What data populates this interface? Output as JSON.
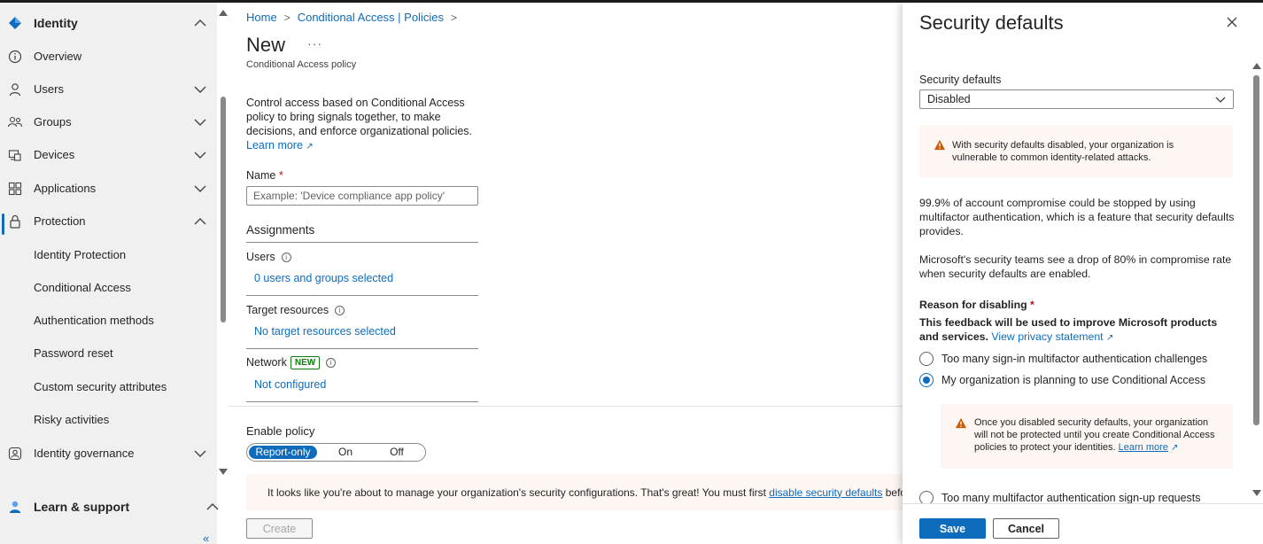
{
  "sidebar": {
    "identity_label": "Identity",
    "items": [
      {
        "label": "Overview",
        "icon": "info-circle-icon"
      },
      {
        "label": "Users",
        "icon": "person-icon"
      },
      {
        "label": "Groups",
        "icon": "people-icon"
      },
      {
        "label": "Devices",
        "icon": "devices-icon"
      },
      {
        "label": "Applications",
        "icon": "apps-grid-icon"
      },
      {
        "label": "Protection",
        "icon": "lock-icon"
      },
      {
        "label": "Identity Protection"
      },
      {
        "label": "Conditional Access"
      },
      {
        "label": "Authentication methods"
      },
      {
        "label": "Password reset"
      },
      {
        "label": "Custom security attributes"
      },
      {
        "label": "Risky activities"
      },
      {
        "label": "Identity governance",
        "icon": "governance-icon"
      }
    ],
    "learn_label": "Learn & support",
    "collapse_glyph": "«",
    "selected": "Protection"
  },
  "main": {
    "breadcrumb": [
      "Home",
      "Conditional Access | Policies"
    ],
    "title": "New",
    "more": "···",
    "subtitle": "Conditional Access policy",
    "description": "Control access based on Conditional Access policy to bring signals together, to make decisions, and enforce organizational policies.",
    "learn_more": "Learn more",
    "name_label": "Name",
    "name_placeholder": "Example: 'Device compliance app policy'",
    "assignments": "Assignments",
    "users_label": "Users",
    "users_value": "0 users and groups selected",
    "target_label": "Target resources",
    "target_value": "No target resources selected",
    "network_label": "Network",
    "network_badge": "NEW",
    "network_value": "Not configured",
    "enable_label": "Enable policy",
    "toggle": [
      "Report-only",
      "On",
      "Off"
    ],
    "toggle_selected": "Report-only",
    "warning_prefix": "It looks like you're about to manage your organization's security configurations. That's great! You must first",
    "warning_link": "disable security defaults",
    "warning_suffix": "before ena",
    "create": "Create"
  },
  "panel": {
    "title": "Security defaults",
    "field_label": "Security defaults",
    "field_value": "Disabled",
    "warn1": "With security defaults disabled, your organization is vulnerable to common identity-related attacks.",
    "para1": "99.9% of account compromise could be stopped by using multifactor authentication, which is a feature that security defaults provides.",
    "para2": "Microsoft's security teams see a drop of 80% in compromise rate when security defaults are enabled.",
    "reason_label": "Reason for disabling",
    "feedback": "This feedback will be used to improve Microsoft products and services.",
    "privacy_link": "View privacy statement",
    "options": [
      "Too many sign-in multifactor authentication challenges",
      "My organization is planning to use Conditional Access",
      "Too many multifactor authentication sign-up requests"
    ],
    "selected_option": "My organization is planning to use Conditional Access",
    "warn2": "Once you disabled security defaults, your organization will not be protected until you create Conditional Access policies to protect your identities.",
    "warn2_link": "Learn more",
    "save": "Save",
    "cancel": "Cancel"
  },
  "colors": {
    "accent": "#0f6cbd",
    "warning": "#c85c06",
    "new_badge": "#107c10",
    "sidebar_bg": "#f0f0f0",
    "warning_bg": "#fdf6f3"
  }
}
